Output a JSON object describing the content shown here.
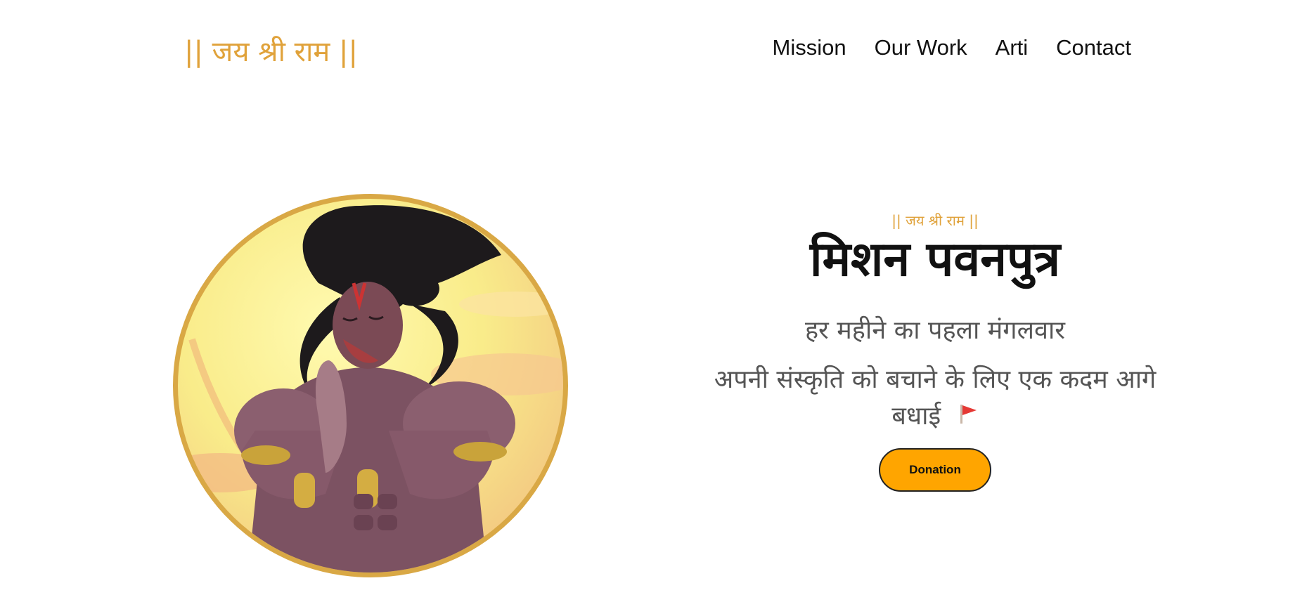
{
  "header": {
    "logo": "|| जय श्री राम ||",
    "nav": [
      {
        "label": "Mission"
      },
      {
        "label": "Our Work"
      },
      {
        "label": "Arti"
      },
      {
        "label": "Contact"
      }
    ]
  },
  "hero": {
    "image_icon": "hanuman-praying-illustration",
    "tagline": "|| जय श्री राम ||",
    "title": "मिशन पवनपुत्र",
    "subtitle": "हर महीने का पहला मंगलवार",
    "description": "अपनी संस्कृति को बचाने के लिए एक कदम आगे बधाई",
    "flag_icon": "red-flag-icon",
    "donate_label": "Donation"
  },
  "colors": {
    "accent": "#e0a23a",
    "button": "#ffa500",
    "text": "#111111",
    "muted": "#555555"
  }
}
